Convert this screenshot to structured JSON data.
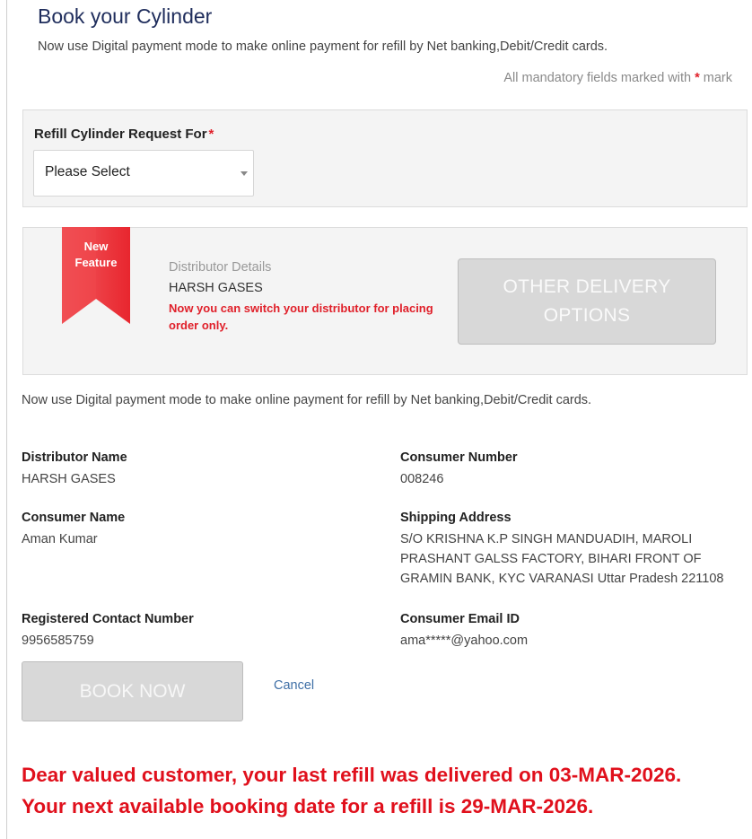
{
  "page": {
    "title": "Book your Cylinder",
    "subtitle": "Now use Digital payment mode to make online payment for refill by Net banking,Debit/Credit cards.",
    "mandatory_text": "All mandatory fields marked with",
    "mandatory_star": "*",
    "mandatory_suffix": "mark"
  },
  "refill": {
    "label": "Refill Cylinder Request For",
    "required_mark": "*",
    "selected": "Please Select"
  },
  "distributor_panel": {
    "ribbon_line1": "New",
    "ribbon_line2": "Feature",
    "label": "Distributor Details",
    "name": "HARSH GASES",
    "note": "Now you can switch your distributor for placing order only.",
    "other_delivery_button": "OTHER DELIVERY OPTIONS"
  },
  "digital_note": "Now use Digital payment mode to make online payment for refill by Net banking,Debit/Credit cards.",
  "details": {
    "distributor_name_label": "Distributor Name",
    "distributor_name": "HARSH GASES",
    "consumer_number_label": "Consumer Number",
    "consumer_number": "008246",
    "consumer_name_label": "Consumer Name",
    "consumer_name": "Aman Kumar",
    "shipping_address_label": "Shipping Address",
    "shipping_address": "S/O KRISHNA K.P SINGH MANDUADIH, MAROLI PRASHANT GALSS FACTORY, BIHARI FRONT OF GRAMIN BANK, KYC VARANASI Uttar Pradesh 221108",
    "contact_label": "Registered Contact Number",
    "contact": "9956585759",
    "email_label": "Consumer Email ID",
    "email": "ama*****@yahoo.com"
  },
  "actions": {
    "book_now": "BOOK NOW",
    "cancel": "Cancel"
  },
  "alert": {
    "line1": "Dear valued customer, your last refill was delivered on 03-MAR-2026.",
    "line2": "Your next available booking date for a refill is 29-MAR-2026."
  },
  "colors": {
    "accent_red": "#e0202a",
    "title_navy": "#1f2d5c",
    "link_blue": "#3f6fa6",
    "disabled_button": "#d8d8d8"
  },
  "icons": {
    "ribbon": "new-feature-ribbon-icon",
    "select_caret": "chevron-down-icon"
  }
}
